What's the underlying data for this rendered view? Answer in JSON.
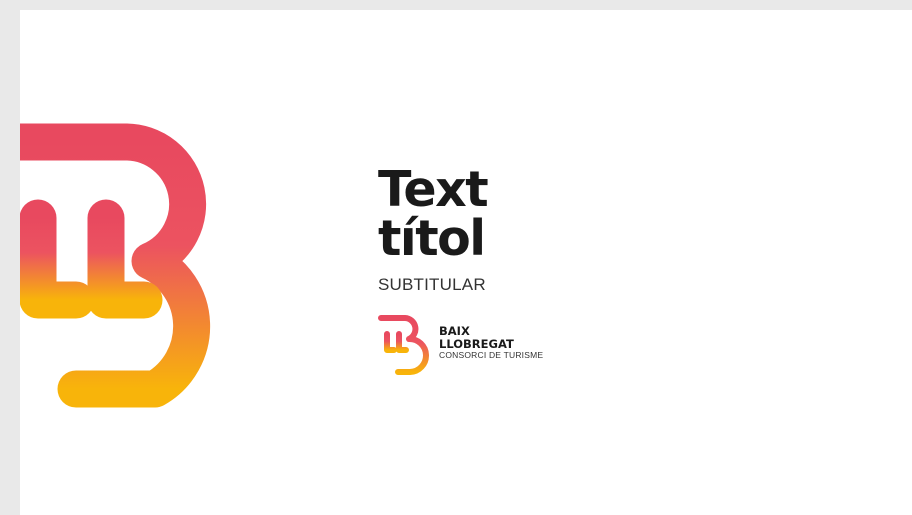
{
  "colors": {
    "background": "#e9e9e9",
    "slide": "#ffffff",
    "gradient_top": "#e8495f",
    "gradient_bottom": "#f8b40a",
    "title_text": "#1a1a1a"
  },
  "logo": {
    "icon_name": "baix-llobregat-ll-b-logo"
  },
  "title": {
    "line1": "Text",
    "line2": "títol"
  },
  "subtitle": "SUBTITULAR",
  "brand": {
    "line1": "BAIX",
    "line2": "LLOBREGAT",
    "line3": "CONSORCI DE TURISME"
  }
}
